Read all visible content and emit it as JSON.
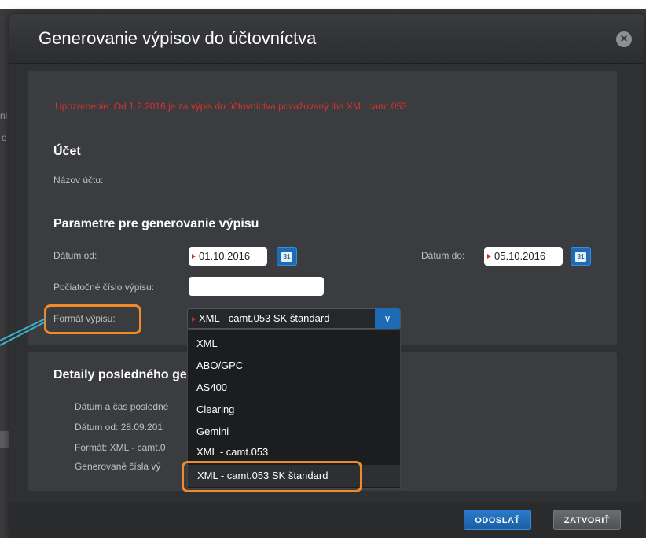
{
  "modal": {
    "title": "Generovanie výpisov do účtovníctva"
  },
  "warning": "Upozornenie: Od 1.2.2016 je za výpis do účtovníctva považovaný iba XML camt.053.",
  "account": {
    "heading": "Účet",
    "name_label": "Názov účtu:"
  },
  "params": {
    "heading": "Parametre pre generovanie výpisu",
    "date_from_label": "Dátum od:",
    "date_from_value": "01.10.2016",
    "date_to_label": "Dátum do:",
    "date_to_value": "05.10.2016",
    "start_number_label": "Počiatočné číslo výpisu:",
    "format_label": "Formát výpisu:",
    "format_selected": "XML - camt.053 SK štandard"
  },
  "format_options": [
    "XML",
    "ABO/GPC",
    "AS400",
    "Clearing",
    "Gemini",
    "XML - camt.053",
    "XML - camt.053 SK štandard"
  ],
  "details": {
    "heading": "Detaily posledného ge",
    "line1": "Dátum a čas posledné",
    "line2": "Dátum od:  28.09.201",
    "line3": "Formát:  XML - camt.0",
    "line4": "Generované čísla vý"
  },
  "buttons": {
    "send": "ODOSLAŤ",
    "close": "ZATVORIŤ"
  },
  "colors": {
    "accent": "#1e6bb5",
    "highlight": "#f08a2a",
    "warning": "#d8312e"
  }
}
